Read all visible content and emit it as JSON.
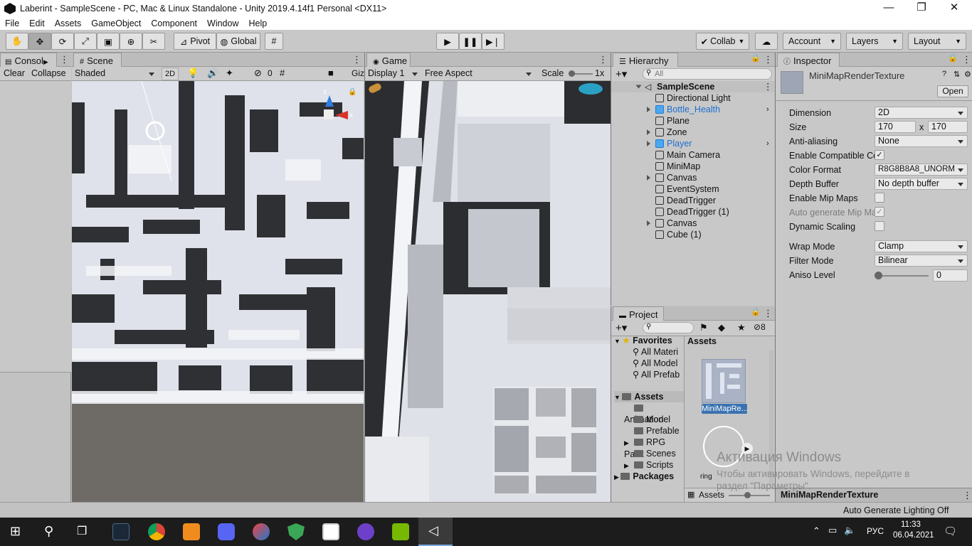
{
  "window": {
    "title": "Laberint - SampleScene - PC, Mac & Linux Standalone - Unity 2019.4.14f1 Personal <DX11>",
    "minimize": "—",
    "restore": "❐",
    "close": "✕"
  },
  "menu": [
    "File",
    "Edit",
    "Assets",
    "GameObject",
    "Component",
    "Window",
    "Help"
  ],
  "toolbar": {
    "pivot": "Pivot",
    "global": "Global",
    "collab": "Collab",
    "account": "Account",
    "layers": "Layers",
    "layout": "Layout"
  },
  "console": {
    "tab": "Consol",
    "clear": "Clear",
    "collapse": "Collapse"
  },
  "scene": {
    "tab": "Scene",
    "shading": "Shaded",
    "mode2d": "2D",
    "hidden_count": "0",
    "gizmos": "Giz",
    "axis_x": "x",
    "axis_z": "z"
  },
  "game": {
    "tab": "Game",
    "display": "Display 1",
    "aspect": "Free Aspect",
    "scale_label": "Scale",
    "scale_value": "1x"
  },
  "hierarchy": {
    "tab": "Hierarchy",
    "search_placeholder": "All",
    "scene": "SampleScene",
    "items": [
      {
        "label": "Directional Light",
        "expand": false,
        "prefab": false
      },
      {
        "label": "Bottle_Health",
        "expand": true,
        "prefab": true
      },
      {
        "label": "Plane",
        "expand": false,
        "prefab": false
      },
      {
        "label": "Zone",
        "expand": true,
        "prefab": false
      },
      {
        "label": "Player",
        "expand": true,
        "prefab": true
      },
      {
        "label": "Main Camera",
        "expand": false,
        "prefab": false
      },
      {
        "label": "MiniMap",
        "expand": false,
        "prefab": false
      },
      {
        "label": "Canvas",
        "expand": true,
        "prefab": false
      },
      {
        "label": "EventSystem",
        "expand": false,
        "prefab": false
      },
      {
        "label": "DeadTrigger",
        "expand": false,
        "prefab": false
      },
      {
        "label": "DeadTrigger (1)",
        "expand": false,
        "prefab": false
      },
      {
        "label": "Canvas",
        "expand": true,
        "prefab": false
      },
      {
        "label": "Cube (1)",
        "expand": false,
        "prefab": false
      }
    ]
  },
  "project": {
    "tab": "Project",
    "hidden_count": "8",
    "favorites": "Favorites",
    "fav_items": [
      "All Materi",
      "All Model",
      "All Prefab"
    ],
    "assets_root": "Assets",
    "asset_folders": [
      "Animation",
      "Model",
      "Prefable",
      "RPG Pack",
      "Scenes",
      "Scripts"
    ],
    "packages": "Packages",
    "assets_header": "Assets",
    "selected_asset": "MiniMapRe...",
    "second_asset": "ring",
    "breadcrumb": "Assets"
  },
  "inspector": {
    "tab": "Inspector",
    "asset_name": "MiniMapRenderTexture",
    "open": "Open",
    "rows": {
      "dimension_label": "Dimension",
      "dimension": "2D",
      "size_label": "Size",
      "size_w": "170",
      "size_x": "x",
      "size_h": "170",
      "aa_label": "Anti-aliasing",
      "aa": "None",
      "compat_label": "Enable Compatible Co",
      "format_label": "Color Format",
      "format": "R8G8B8A8_UNORM",
      "depth_label": "Depth Buffer",
      "depth": "No depth buffer",
      "mip_label": "Enable Mip Maps",
      "automip_label": "Auto generate Mip Ma",
      "dyn_label": "Dynamic Scaling",
      "wrap_label": "Wrap Mode",
      "wrap": "Clamp",
      "filter_label": "Filter Mode",
      "filter": "Bilinear",
      "aniso_label": "Aniso Level",
      "aniso": "0"
    },
    "footer": "MiniMapRenderTexture"
  },
  "status": {
    "lighting": "Auto Generate Lighting Off"
  },
  "watermark": {
    "line1": "Активация Windows",
    "line2": "Чтобы активировать Windows, перейдите в",
    "line3": "раздел \"Параметры\"."
  },
  "taskbar": {
    "lang": "РУС",
    "time": "11:33",
    "date": "06.04.2021"
  },
  "colors": {
    "editor_bg": "#c2c2c2",
    "prefab_blue": "#1e6fd0",
    "selection": "#3a72b0",
    "taskbar": "#1c1c1c"
  }
}
